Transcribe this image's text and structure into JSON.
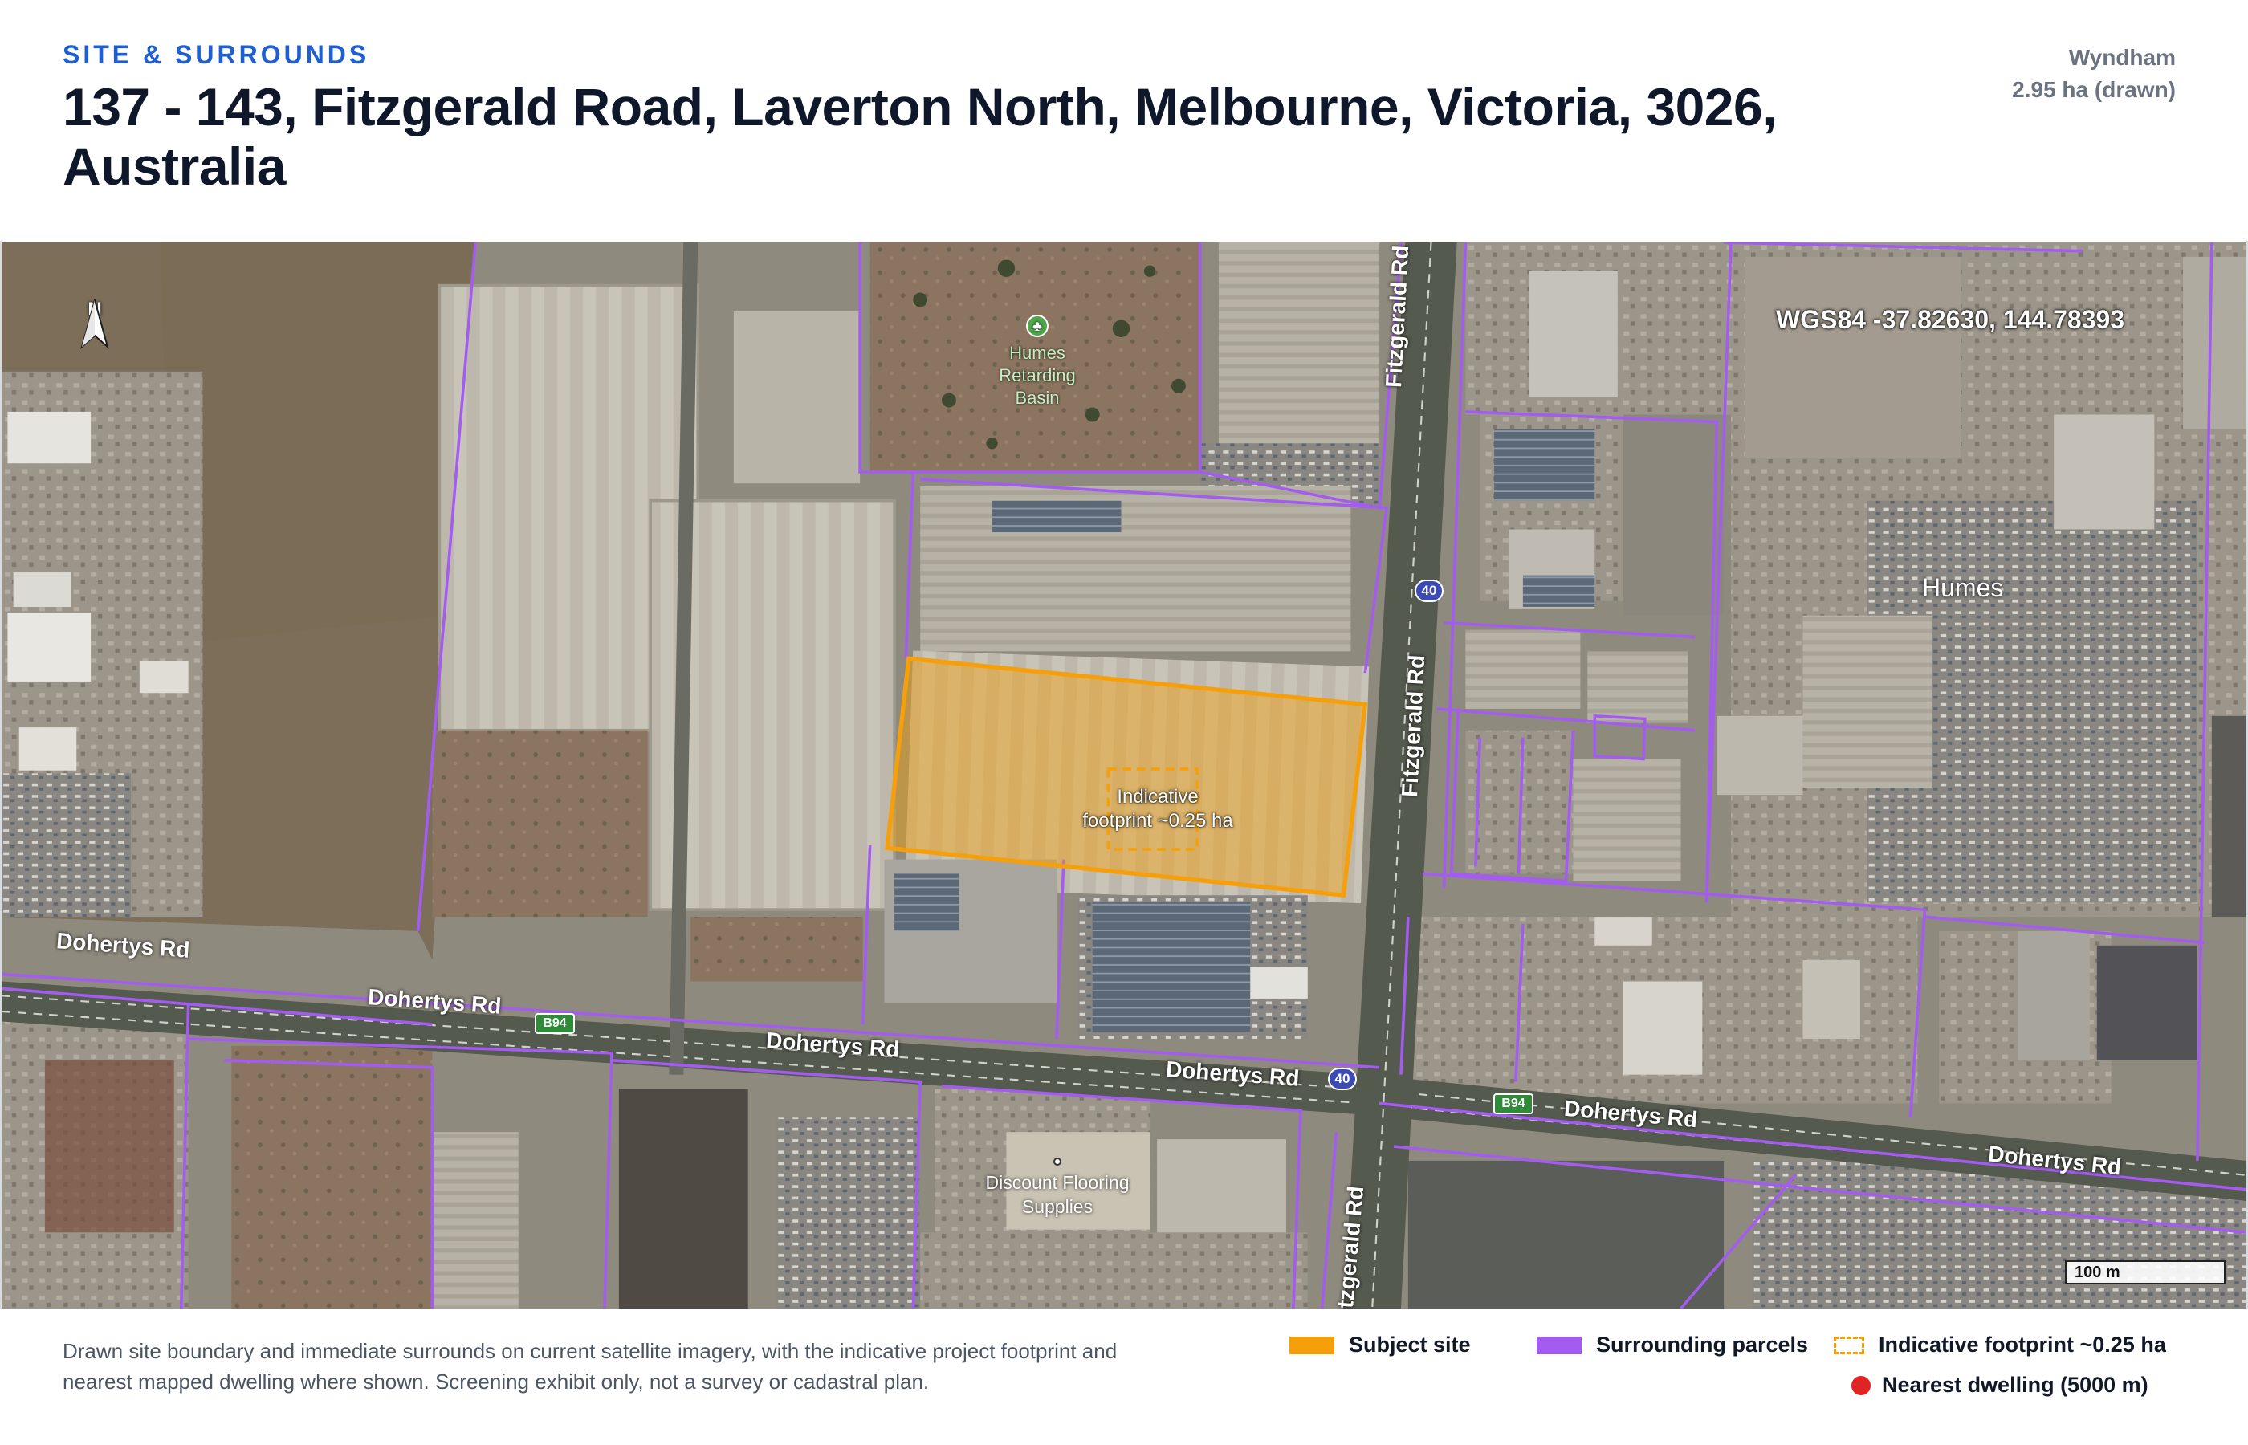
{
  "header": {
    "kicker": "SITE & SURROUNDS",
    "title": "137 - 143, Fitzgerald Road, Laverton North, Melbourne, Victoria, 3026, Australia",
    "lga": "Wyndham",
    "area": "2.95 ha (drawn)"
  },
  "map": {
    "north_label": "N",
    "coords": "WGS84 -37.82630, 144.78393",
    "scale_label": "100 m",
    "site_label_line1": "Indicative",
    "site_label_line2": "footprint ~0.25 ha",
    "poi_basin_line1": "Humes",
    "poi_basin_line2": "Retarding",
    "poi_basin_line3": "Basin",
    "poi_humes": "Humes",
    "poi_flooring_line1": "Discount Flooring",
    "poi_flooring_line2": "Supplies",
    "roads": {
      "dohertys": "Dohertys Rd",
      "fitzgerald": "Fitzgerald Rd",
      "fitzgerald_partial": "tzgerald Rd",
      "shield_40": "40",
      "shield_b94": "B94"
    },
    "colors": {
      "subject": "#f5a00b",
      "parcels": "#a45cf0",
      "dwelling": "#e02424"
    }
  },
  "footer": {
    "caption": "Drawn site boundary and immediate surrounds on current satellite imagery, with the indicative project footprint and nearest mapped dwelling where shown. Screening exhibit only, not a survey or cadastral plan.",
    "legend": {
      "subject": "Subject site",
      "parcels": "Surrounding parcels",
      "footprint": "Indicative footprint ~0.25 ha",
      "dwelling": "Nearest dwelling (5000 m)"
    }
  }
}
